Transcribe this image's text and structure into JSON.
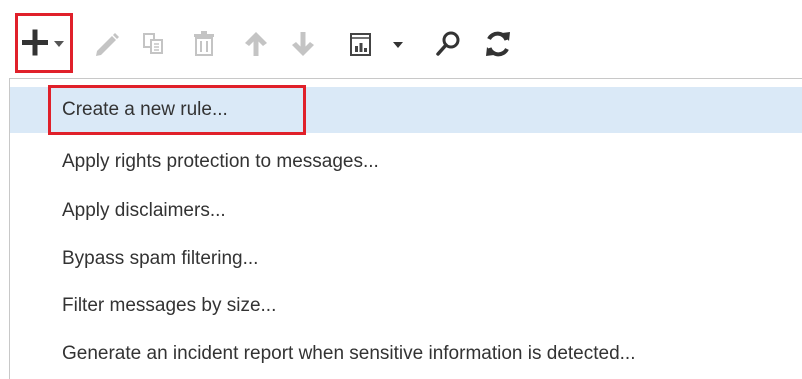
{
  "toolbar": {
    "buttons": [
      {
        "icon": "plus-icon",
        "has_dropdown": true,
        "enabled": true
      },
      {
        "icon": "pencil-icon",
        "enabled": false
      },
      {
        "icon": "copy-icon",
        "enabled": false
      },
      {
        "icon": "trash-icon",
        "enabled": false
      },
      {
        "icon": "arrow-up-icon",
        "enabled": false
      },
      {
        "icon": "arrow-down-icon",
        "enabled": false
      },
      {
        "icon": "report-icon",
        "has_dropdown": true,
        "enabled": true
      },
      {
        "icon": "search-icon",
        "enabled": true
      },
      {
        "icon": "refresh-icon",
        "enabled": true
      }
    ]
  },
  "menu": {
    "items": [
      {
        "label": "Create a new rule...",
        "selected": true
      },
      {
        "label": "Apply rights protection to messages..."
      },
      {
        "label": "Apply disclaimers..."
      },
      {
        "label": "Bypass spam filtering..."
      },
      {
        "label": "Filter messages by size..."
      },
      {
        "label": "Generate an incident report when sensitive information is detected..."
      }
    ]
  },
  "colors": {
    "highlight_box": "#e0202a",
    "selected_row": "#dae9f7",
    "icon_active": "#333333",
    "icon_disabled": "#c4c4c4",
    "menu_text": "#333333"
  }
}
